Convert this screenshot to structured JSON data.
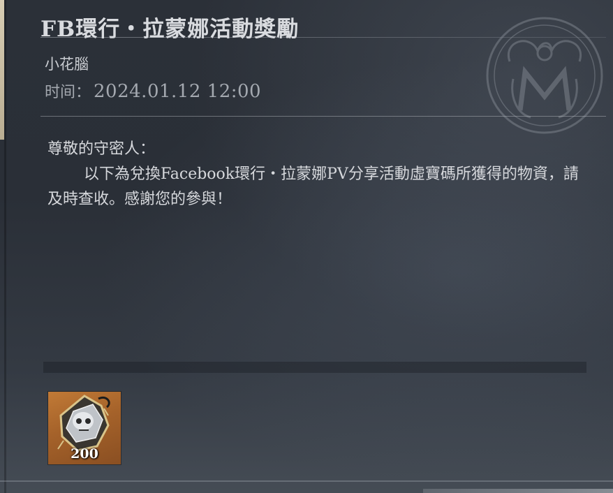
{
  "mail": {
    "title": "FB環行・拉蒙娜活動獎勵",
    "sender": "小花腦",
    "time_label": "时间：",
    "time_value": "2024.01.12 12:00",
    "greeting": "尊敬的守密人：",
    "message": "以下為兌換Facebook環行・拉蒙娜PV分享活動虛寶碼所獲得的物資，請及時查收。感謝您的參與！"
  },
  "attachments": [
    {
      "icon": "crystal-skull-icon",
      "quantity": "200"
    }
  ],
  "colors": {
    "background": "#2b3038",
    "title": "#d9dbdf",
    "body_text": "#d6d8dc",
    "meta_text": "#a4a9b0",
    "item_frame": "#b06a2e"
  }
}
